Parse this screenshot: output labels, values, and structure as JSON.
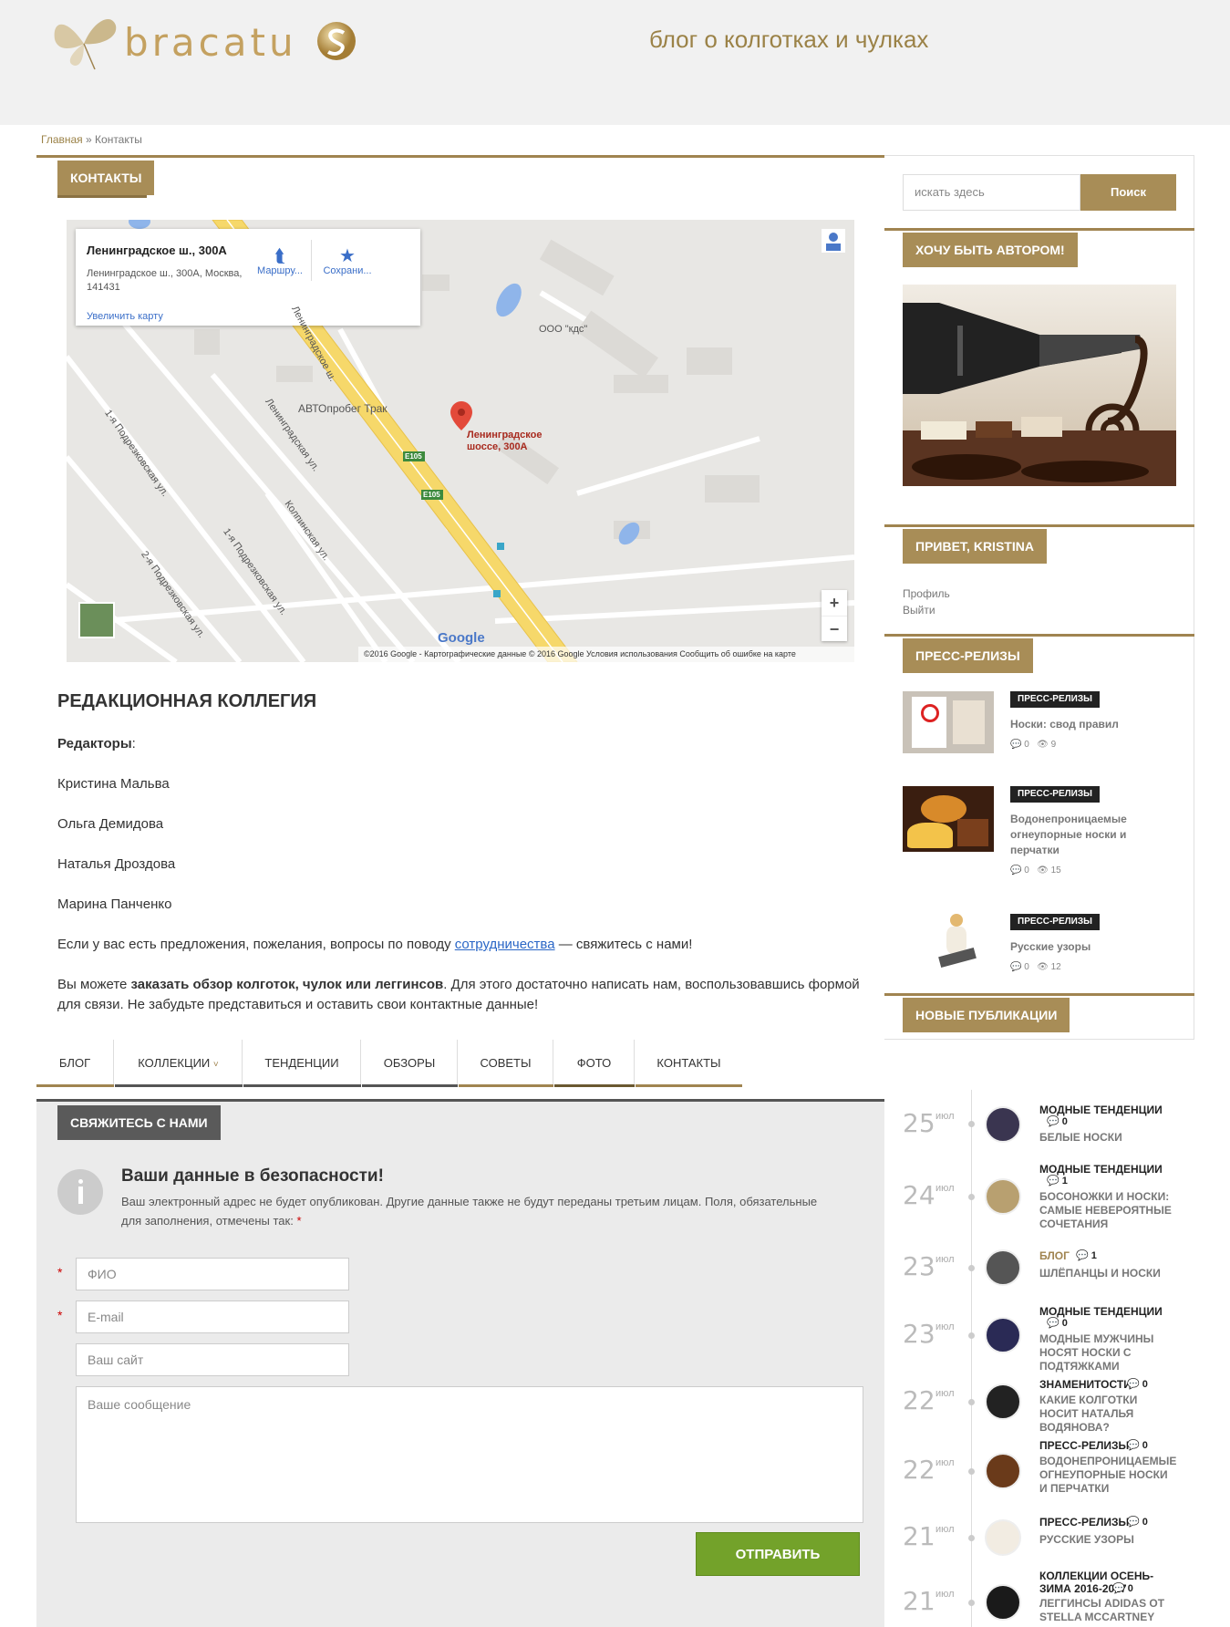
{
  "header": {
    "logo_text": "bracatu",
    "tagline": "блог о колготках и чулках"
  },
  "breadcrumb": {
    "home": "Главная",
    "sep": " » ",
    "current": "Контакты"
  },
  "main": {
    "title": "КОНТАКТЫ",
    "map": {
      "card_title": "Ленинградское ш., 300А",
      "card_address": "Ленинградское ш., 300А, Москва, 141431",
      "enlarge": "Увеличить карту",
      "route": "Маршру...",
      "save": "Сохрани...",
      "pin_label": "Ленинградское шоссе, 300А",
      "labels": {
        "kds": "ООО \"кдс\"",
        "avto": "АВТОпробег Трак",
        "e105a": "E105",
        "e105b": "E105",
        "ul1": "1-я Подрезковская ул.",
        "ul2": "Ленинградская ул.",
        "ul3": "Колпинская ул.",
        "ul4": "1-я Подрезковская ул.",
        "ul5": "2-я Подрезковская ул.",
        "ul6": "Ленинградское ш."
      },
      "footer": "©2016 Google - Картографические данные © 2016 Google     Условия использования     Сообщить об ошибке на карте",
      "google": "Google",
      "zoom_in": "+",
      "zoom_out": "−"
    },
    "editorial_title": "РЕДАКЦИОННАЯ КОЛЛЕГИЯ",
    "editors_label": "Редакторы",
    "editors_colon": ":",
    "editors": [
      "Кристина Мальва",
      "Ольга Демидова",
      "Наталья Дроздова",
      "Марина Панченко"
    ],
    "p1_before": "Если у вас есть предложения, пожелания, вопросы по поводу ",
    "p1_link": "сотрудничества",
    "p1_after": " — свяжитесь с нами!",
    "p2_before": "Вы можете ",
    "p2_bold": "заказать обзор колготок, чулок или леггинсов",
    "p2_after": ". Для этого достаточно написать нам, воспользовавшись формой для связи. Не забудьте представиться и оставить свои контактные данные!"
  },
  "nav": {
    "items": [
      "БЛОГ",
      "КОЛЛЕКЦИИ",
      "ТЕНДЕНЦИИ",
      "ОБЗОРЫ",
      "СОВЕТЫ",
      "ФОТО",
      "КОНТАКТЫ"
    ],
    "dropdown_glyph": "˅"
  },
  "contact": {
    "title": "СВЯЖИТЕСЬ С НАМИ",
    "notice_title": "Ваши данные в безопасности!",
    "notice_text": "Ваш электронный адрес не будет опубликован. Другие данные также не будут переданы третьим лицам. Поля, обязательные для заполнения, отмечены так:",
    "required_mark": "*",
    "name_placeholder": "ФИО",
    "email_placeholder": "E-mail",
    "site_placeholder": "Ваш сайт",
    "message_placeholder": "Ваше сообщение",
    "submit": "ОТПРАВИТЬ"
  },
  "sidebar": {
    "search_placeholder": "искать здесь",
    "search_button": "Поиск",
    "author_title": "ХОЧУ БЫТЬ АВТОРОМ!",
    "hello_title": "ПРИВЕТ, KRISTINA",
    "profile": "Профиль",
    "logout": "Выйти",
    "press_title": "ПРЕСС-РЕЛИЗЫ",
    "press_items": [
      {
        "badge": "ПРЕСС-РЕЛИЗЫ",
        "title": "Носки: свод правил",
        "comments": "0",
        "views": "9"
      },
      {
        "badge": "ПРЕСС-РЕЛИЗЫ",
        "title": "Водонепроницаемые огнеупорные носки и перчатки",
        "comments": "0",
        "views": "15"
      },
      {
        "badge": "ПРЕСС-РЕЛИЗЫ",
        "title": "Русские узоры",
        "comments": "0",
        "views": "12"
      }
    ],
    "new_title": "НОВЫЕ ПУБЛИКАЦИИ",
    "new_items": [
      {
        "day": "25",
        "month": "июл",
        "cat": "МОДНЫЕ ТЕНДЕНЦИИ",
        "comments": "0",
        "title": "БЕЛЫЕ НОСКИ"
      },
      {
        "day": "24",
        "month": "июл",
        "cat": "МОДНЫЕ ТЕНДЕНЦИИ",
        "comments": "1",
        "title": "БОСОНОЖКИ И НОСКИ: САМЫЕ НЕВЕРОЯТНЫЕ СОЧЕТАНИЯ"
      },
      {
        "day": "23",
        "month": "июл",
        "cat": "БЛОГ",
        "comments": "1",
        "title": "ШЛЁПАНЦЫ И НОСКИ"
      },
      {
        "day": "23",
        "month": "июл",
        "cat": "МОДНЫЕ ТЕНДЕНЦИИ",
        "comments": "0",
        "title": "МОДНЫЕ МУЖЧИНЫ НОСЯТ НОСКИ С ПОДТЯЖКАМИ"
      },
      {
        "day": "22",
        "month": "июл",
        "cat": "ЗНАМЕНИТОСТИ",
        "comments": "0",
        "title": "КАКИЕ КОЛГОТКИ НОСИТ НАТАЛЬЯ ВОДЯНОВА?"
      },
      {
        "day": "22",
        "month": "июл",
        "cat": "ПРЕСС-РЕЛИЗЫ",
        "comments": "0",
        "title": "ВОДОНЕПРОНИЦАЕМЫЕ ОГНЕУПОРНЫЕ НОСКИ И ПЕРЧАТКИ"
      },
      {
        "day": "21",
        "month": "июл",
        "cat": "ПРЕСС-РЕЛИЗЫ",
        "comments": "0",
        "title": "РУССКИЕ УЗОРЫ"
      },
      {
        "day": "21",
        "month": "июл",
        "cat": "КОЛЛЕКЦИИ ОСЕНЬ-ЗИМА 2016-2017",
        "comments": "0",
        "title": "ЛЕГГИНСЫ ADIDAS ОТ STELLA MCCARTNEY"
      }
    ]
  },
  "colors": {
    "gold": "#a88d57",
    "nav_active": "#7a6a45",
    "submit": "#73a22a",
    "contact_tab": "#5a5a5a"
  }
}
